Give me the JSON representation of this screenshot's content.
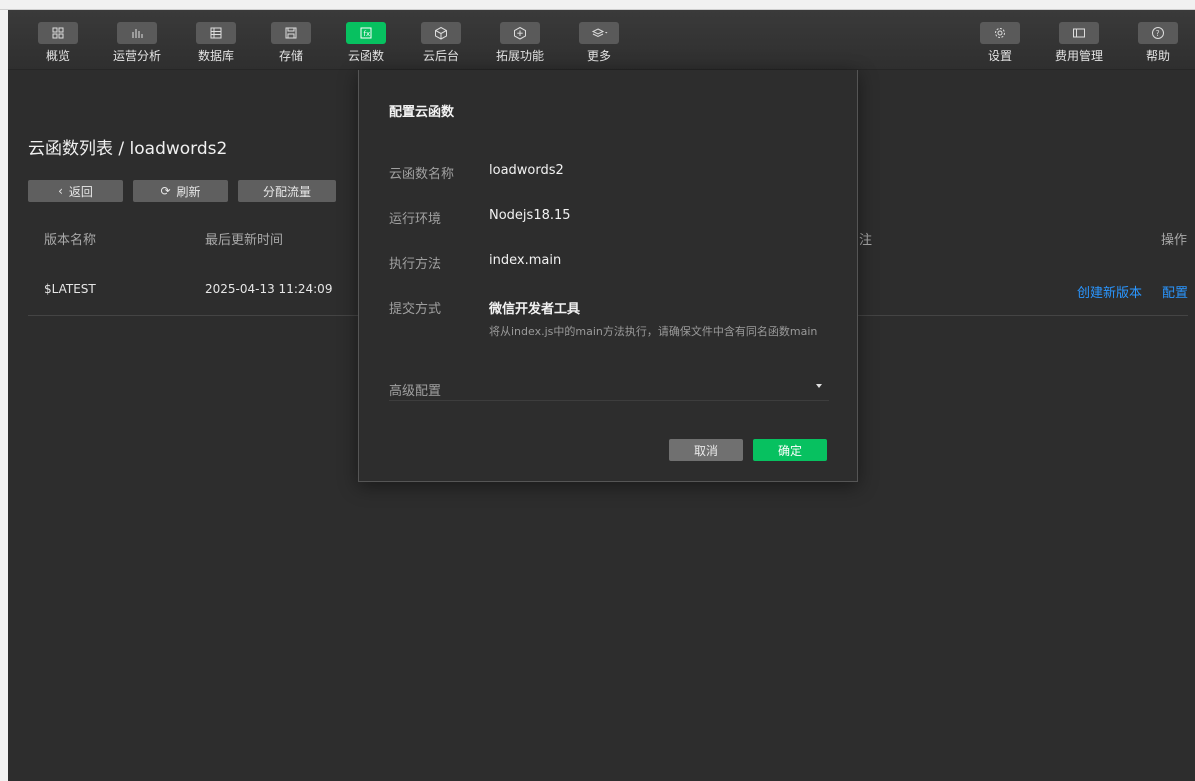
{
  "toolbar": {
    "items": [
      {
        "label": "概览",
        "icon": "grid-icon"
      },
      {
        "label": "运营分析",
        "icon": "bar-chart-icon"
      },
      {
        "label": "数据库",
        "icon": "database-icon"
      },
      {
        "label": "存储",
        "icon": "save-icon"
      },
      {
        "label": "云函数",
        "icon": "function-icon",
        "active": true
      },
      {
        "label": "云后台",
        "icon": "cube-icon"
      },
      {
        "label": "拓展功能",
        "icon": "extension-icon"
      },
      {
        "label": "更多",
        "icon": "layers-icon"
      },
      {
        "label": "设置",
        "icon": "gear-icon"
      },
      {
        "label": "费用管理",
        "icon": "card-icon"
      },
      {
        "label": "帮助",
        "icon": "help-icon"
      }
    ],
    "accent_color": "#07c160"
  },
  "page": {
    "title": "云函数列表 / loadwords2",
    "back_label": "返回",
    "refresh_label": "刷新",
    "traffic_label": "分配流量"
  },
  "table": {
    "headers": [
      "版本名称",
      "最后更新时间",
      "注",
      "操作"
    ],
    "rows": [
      {
        "version": "$LATEST",
        "updated": "2025-04-13 11:24:09",
        "action_create": "创建新版本",
        "action_config": "配置"
      }
    ]
  },
  "modal": {
    "title": "配置云函数",
    "fields": [
      {
        "label": "云函数名称",
        "value": "loadwords2"
      },
      {
        "label": "运行环境",
        "value": "Nodejs18.15"
      },
      {
        "label": "执行方法",
        "value": "index.main"
      },
      {
        "label": "提交方式",
        "value": "微信开发者工具"
      }
    ],
    "hint": "将从index.js中的main方法执行，请确保文件中含有同名函数main",
    "advanced_label": "高级配置",
    "cancel_label": "取消",
    "ok_label": "确定"
  }
}
